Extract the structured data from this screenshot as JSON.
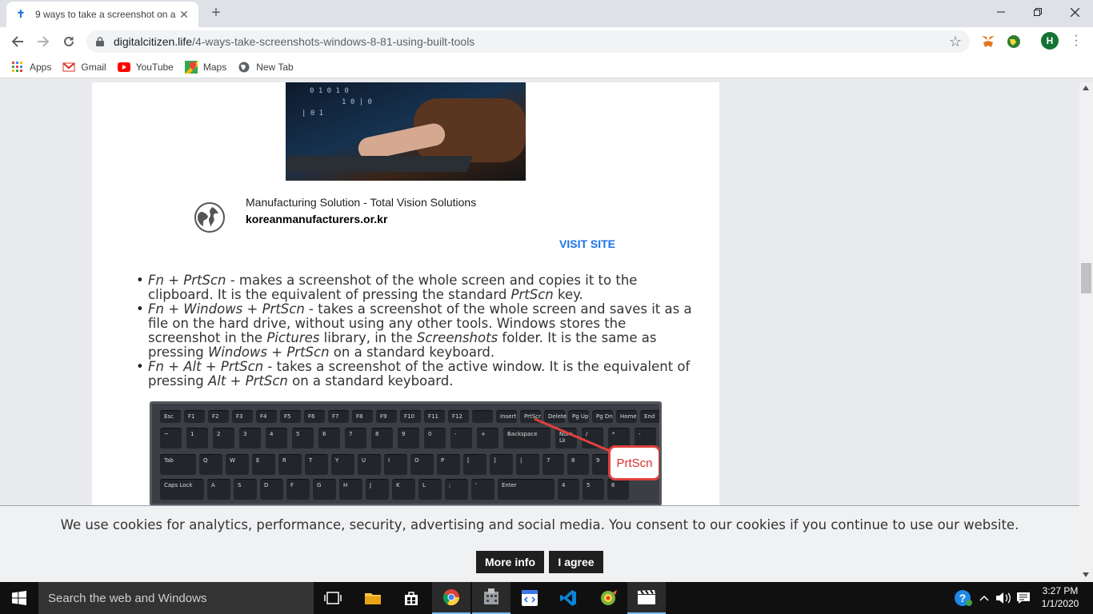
{
  "browser": {
    "tab_title": "9 ways to take a screenshot on a",
    "url_host": "digitalcitizen.life",
    "url_path": "/4-ways-take-screenshots-windows-8-81-using-built-tools",
    "avatar_letter": "H"
  },
  "bookmarks": [
    {
      "label": "Apps",
      "icon": "apps-grid-icon"
    },
    {
      "label": "Gmail",
      "icon": "gmail-icon"
    },
    {
      "label": "YouTube",
      "icon": "youtube-icon"
    },
    {
      "label": "Maps",
      "icon": "maps-icon"
    },
    {
      "label": "New Tab",
      "icon": "globe-icon"
    }
  ],
  "ad": {
    "title": "Manufacturing Solution - Total Vision Solutions",
    "domain": "koreanmanufacturers.or.kr",
    "cta": "VISIT SITE"
  },
  "bullets": [
    {
      "parts": [
        [
          "i",
          "Fn + PrtScn"
        ],
        [
          "t",
          " - makes a screenshot of the whole screen and copies it to the clipboard. It is the equivalent of pressing the standard "
        ],
        [
          "i",
          "PrtScn"
        ],
        [
          "t",
          " key."
        ]
      ]
    },
    {
      "parts": [
        [
          "i",
          "Fn + Windows + PrtScn"
        ],
        [
          "t",
          " - takes a screenshot of the whole screen and saves it as a file on the hard drive, without using any other tools. Windows stores the screenshot in the "
        ],
        [
          "i",
          "Pictures"
        ],
        [
          "t",
          " library, in the "
        ],
        [
          "i",
          "Screenshots"
        ],
        [
          "t",
          " folder. It is the same as pressing "
        ],
        [
          "i",
          "Windows + PrtScn"
        ],
        [
          "t",
          " on a standard keyboard."
        ]
      ]
    },
    {
      "parts": [
        [
          "i",
          "Fn + Alt + PrtScn"
        ],
        [
          "t",
          " - takes a screenshot of the active window. It is the equivalent of pressing "
        ],
        [
          "i",
          "Alt + PrtScn"
        ],
        [
          "t",
          " on a standard keyboard."
        ]
      ]
    }
  ],
  "keyboard": {
    "callout": "PrtScn",
    "row0": [
      "Esc",
      "F1",
      "F2",
      "F3",
      "F4",
      "F5",
      "F6",
      "F7",
      "F8",
      "F9",
      "F10",
      "F11",
      "F12",
      "",
      "Insert",
      "PrtScr",
      "Delete",
      "Pg Up",
      "Pg Dn",
      "Home",
      "End"
    ],
    "row1": [
      "~",
      "1",
      "2",
      "3",
      "4",
      "5",
      "6",
      "7",
      "8",
      "9",
      "0",
      "-",
      "+",
      "Backspace",
      "Num Lk",
      "/",
      "*",
      "-"
    ],
    "row2": [
      "Tab",
      "Q",
      "W",
      "E",
      "R",
      "T",
      "Y",
      "U",
      "I",
      "O",
      "P",
      "[",
      "]",
      "|",
      "7",
      "8",
      "9",
      "+"
    ],
    "row3": [
      "Caps Lock",
      "A",
      "S",
      "D",
      "F",
      "G",
      "H",
      "J",
      "K",
      "L",
      ";",
      "'",
      "Enter",
      "4",
      "5",
      "6"
    ]
  },
  "cookie": {
    "text": "We use cookies for analytics, performance, security, advertising and social media. You consent to our cookies if you continue to use our website.",
    "more_info": "More info",
    "agree": "I agree"
  },
  "taskbar": {
    "search_placeholder": "Search the web and Windows",
    "time": "3:27 PM",
    "date": "1/1/2020"
  }
}
